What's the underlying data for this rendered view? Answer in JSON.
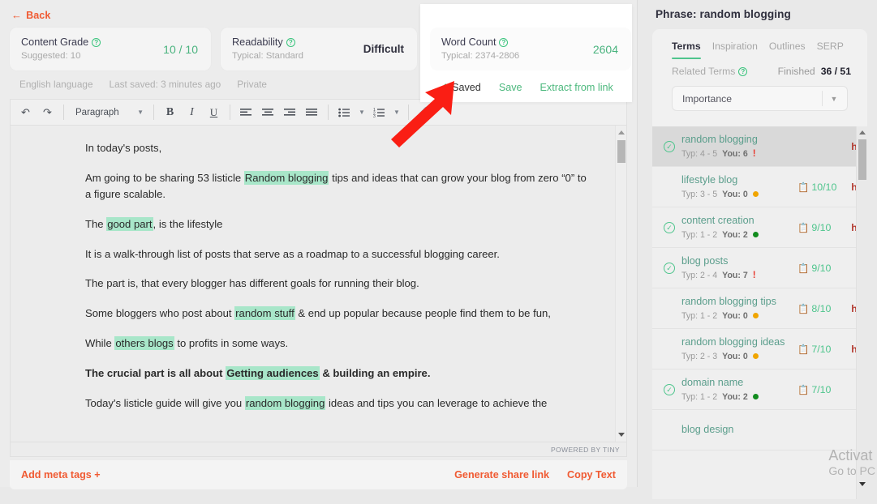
{
  "nav": {
    "back_label": "Back",
    "back_icon": "arrow-left-icon"
  },
  "scores": {
    "grade": {
      "title": "Content Grade",
      "sub": "Suggested: 10",
      "value": "10 / 10"
    },
    "readability": {
      "title": "Readability",
      "sub": "Typical: Standard",
      "value": "Difficult"
    },
    "wordcount": {
      "title": "Word Count",
      "sub": "Typical: 2374-2806",
      "value": "2604"
    }
  },
  "meta": {
    "language": "English language",
    "last_saved": "Last saved: 3 minutes ago",
    "visibility": "Private"
  },
  "save_overlay": {
    "saved_label": "Saved",
    "save_label": "Save",
    "extract_label": "Extract from link",
    "check_icon": "check-icon"
  },
  "toolbar": {
    "undo_icon": "undo-icon",
    "redo_icon": "redo-icon",
    "format_select": "Paragraph",
    "bold": "B",
    "italic": "I",
    "underline": "U",
    "align_left_icon": "align-left-icon",
    "align_center_icon": "align-center-icon",
    "align_right_icon": "align-right-icon",
    "align_justify_icon": "align-justify-icon",
    "bullet_list_icon": "bullet-list-icon",
    "numbered_list_icon": "numbered-list-icon",
    "link_icon": "link-icon"
  },
  "editor": {
    "paragraphs": [
      {
        "parts": [
          {
            "t": "In today's posts,",
            "h": false
          }
        ],
        "bold": false
      },
      {
        "parts": [
          {
            "t": "Am going to be sharing 53 listicle ",
            "h": false
          },
          {
            "t": "Random blogging",
            "h": true
          },
          {
            "t": " tips and ideas that can grow your blog from zero “0” to a figure scalable.",
            "h": false
          }
        ],
        "bold": false
      },
      {
        "parts": [
          {
            "t": "The ",
            "h": false
          },
          {
            "t": "good part",
            "h": true
          },
          {
            "t": ", is the lifestyle",
            "h": false
          }
        ],
        "bold": false
      },
      {
        "parts": [
          {
            "t": "It is a walk-through list of posts that serve as a roadmap to a successful blogging career.",
            "h": false
          }
        ],
        "bold": false
      },
      {
        "parts": [
          {
            "t": "The part is, that every blogger has different goals for running their blog.",
            "h": false
          }
        ],
        "bold": false
      },
      {
        "parts": [
          {
            "t": "Some bloggers who post about ",
            "h": false
          },
          {
            "t": "random stuff",
            "h": true
          },
          {
            "t": " & end up popular because people find them to be fun,",
            "h": false
          }
        ],
        "bold": false
      },
      {
        "parts": [
          {
            "t": "While ",
            "h": false
          },
          {
            "t": "others blogs",
            "h": true
          },
          {
            "t": " to profits in some ways.",
            "h": false
          }
        ],
        "bold": false
      },
      {
        "parts": [
          {
            "t": "The crucial part is all about ",
            "h": false
          },
          {
            "t": "Getting audiences",
            "h": true
          },
          {
            "t": " & building an empire.",
            "h": false
          }
        ],
        "bold": true
      },
      {
        "parts": [
          {
            "t": "Today's listicle guide will give you ",
            "h": false
          },
          {
            "t": "random blogging",
            "h": true
          },
          {
            "t": " ideas and tips you can leverage to achieve the",
            "h": false
          }
        ],
        "bold": false
      }
    ],
    "powered_by": "POWERED BY TINY"
  },
  "bottom_bar": {
    "add_meta": "Add meta tags +",
    "generate_link": "Generate share link",
    "copy_text": "Copy Text"
  },
  "sidebar": {
    "title": "Phrase: random blogging",
    "tabs": [
      {
        "label": "Terms",
        "active": true
      },
      {
        "label": "Inspiration",
        "active": false
      },
      {
        "label": "Outlines",
        "active": false
      },
      {
        "label": "SERP",
        "active": false
      }
    ],
    "related_terms_label": "Related Terms",
    "finished_label": "Finished",
    "finished_value": "36 / 51",
    "sort_select": "Importance",
    "terms": [
      {
        "name": "random blogging",
        "typ": "Typ: 4 - 5",
        "you": "You: 6",
        "flag": "!",
        "dot": "",
        "score": "",
        "h": "h",
        "checked": true,
        "selected": true
      },
      {
        "name": "lifestyle blog",
        "typ": "Typ: 3 - 5",
        "you": "You: 0",
        "flag": "",
        "dot": "#f0a500",
        "score": "10/10",
        "h": "h",
        "checked": false,
        "selected": false
      },
      {
        "name": "content creation",
        "typ": "Typ: 1 - 2",
        "you": "You: 2",
        "flag": "",
        "dot": "#128c1e",
        "score": "9/10",
        "h": "h",
        "checked": true,
        "selected": false
      },
      {
        "name": "blog posts",
        "typ": "Typ: 2 - 4",
        "you": "You: 7",
        "flag": "!",
        "dot": "",
        "score": "9/10",
        "h": "",
        "checked": true,
        "selected": false
      },
      {
        "name": "random blogging tips",
        "typ": "Typ: 1 - 2",
        "you": "You: 0",
        "flag": "",
        "dot": "#f0a500",
        "score": "8/10",
        "h": "h",
        "checked": false,
        "selected": false
      },
      {
        "name": "random blogging ideas",
        "typ": "Typ: 2 - 3",
        "you": "You: 0",
        "flag": "",
        "dot": "#f0a500",
        "score": "7/10",
        "h": "h",
        "checked": false,
        "selected": false
      },
      {
        "name": "domain name",
        "typ": "Typ: 1 - 2",
        "you": "You: 2",
        "flag": "",
        "dot": "#128c1e",
        "score": "7/10",
        "h": "",
        "checked": true,
        "selected": false
      },
      {
        "name": "blog design",
        "typ": "",
        "you": "",
        "flag": "",
        "dot": "",
        "score": "",
        "h": "",
        "checked": false,
        "selected": false
      }
    ]
  },
  "watermark": {
    "line1": "Activat",
    "line2": "Go to PC"
  },
  "colors": {
    "accent_orange": "#f05a32",
    "green": "#4fc58d",
    "highlight": "#a8e6c9",
    "red_arrow": "#fa1e14"
  }
}
